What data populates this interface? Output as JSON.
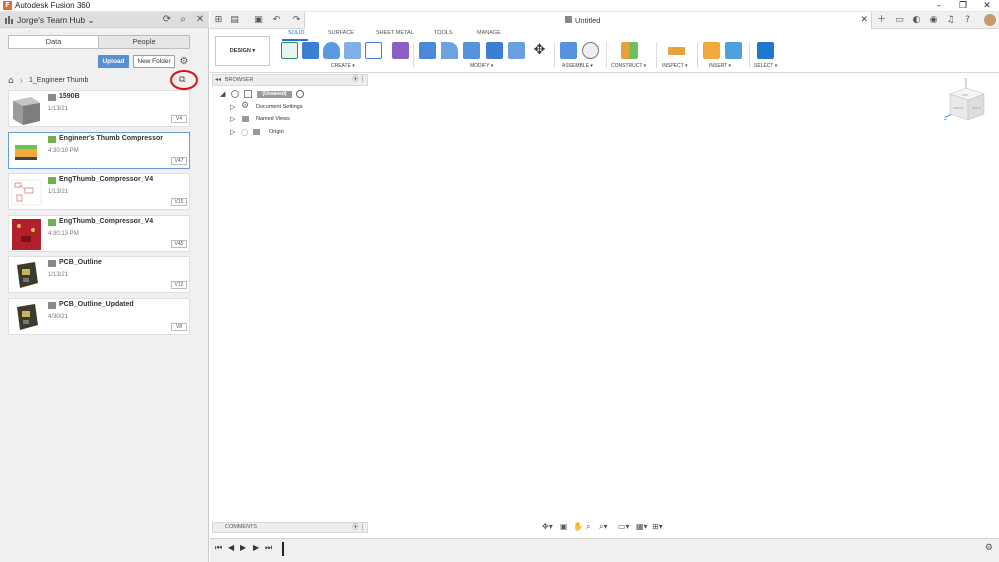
{
  "window": {
    "title": "Autodesk Fusion 360",
    "logo_letter": "F"
  },
  "data_panel": {
    "hub_name": "Jorge's Team Hub",
    "tabs": [
      {
        "label": "Data",
        "active": true
      },
      {
        "label": "People",
        "active": false
      }
    ],
    "upload_label": "Upload",
    "new_folder_label": "New Folder",
    "breadcrumb_folder": "1_Engineer Thumb",
    "files": [
      {
        "name": "1590B",
        "date": "1/13/21",
        "version": "V4"
      },
      {
        "name": "Engineer's Thumb Compressor",
        "date": "4:30:19 PM",
        "version": "V47"
      },
      {
        "name": "EngThumb_Compressor_V4",
        "date": "1/13/21",
        "version": "V15"
      },
      {
        "name": "EngThumb_Compressor_V4",
        "date": "4:30:13 PM",
        "version": "V45"
      },
      {
        "name": "PCB_Outline",
        "date": "1/13/21",
        "version": "V12"
      },
      {
        "name": "PCB_Outline_Updated",
        "date": "4/30/21",
        "version": "V8"
      }
    ]
  },
  "document": {
    "tab_name": "Untitled"
  },
  "ribbon": {
    "workspace": "DESIGN ▾",
    "tabs": [
      "SOLID",
      "SURFACE",
      "SHEET METAL",
      "TOOLS",
      "MANAGE"
    ],
    "groups": [
      "CREATE ▾",
      "MODIFY ▾",
      "ASSEMBLE ▾",
      "CONSTRUCT ▾",
      "INSPECT ▾",
      "INSERT ▾",
      "SELECT ▾"
    ]
  },
  "browser": {
    "label": "BROWSER",
    "root": "(Unsaved)",
    "items": [
      "Document Settings",
      "Named Views",
      "Origin"
    ]
  },
  "comments": {
    "label": "COMMENTS"
  },
  "viewcube": {
    "axis_x": "X",
    "axis_y": "Y",
    "axis_z": "Z",
    "top": "TOP",
    "front": "FRONT",
    "right": "RIGHT"
  },
  "colors": {
    "accent": "#1e78d2",
    "upload": "#5a8fd0",
    "highlight_circle": "#d9111d"
  }
}
